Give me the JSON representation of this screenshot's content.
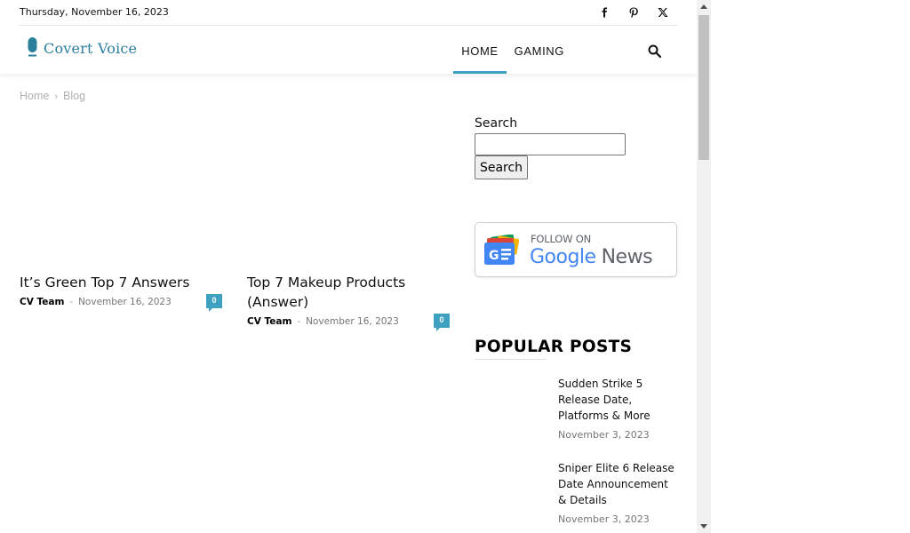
{
  "topbar": {
    "date": "Thursday, November 16, 2023",
    "social": [
      {
        "name": "facebook-icon"
      },
      {
        "name": "pinterest-icon"
      },
      {
        "name": "x-twitter-icon"
      }
    ]
  },
  "header": {
    "logo_text": "Covert Voice",
    "nav": [
      {
        "label": "HOME",
        "active": true
      },
      {
        "label": "GAMING",
        "active": false
      }
    ],
    "search_icon": "search-icon"
  },
  "breadcrumb": {
    "items": [
      "Home",
      "Blog"
    ],
    "separator": "›"
  },
  "posts": [
    {
      "title": "It’s Green Top 7 Answers",
      "author": "CV Team",
      "dash": "-",
      "date": "November 16, 2023",
      "comments": "0"
    },
    {
      "title": "Top 7 Makeup Products (Answer)",
      "author": "CV Team",
      "dash": "-",
      "date": "November 16, 2023",
      "comments": "0"
    }
  ],
  "sidebar": {
    "search_label": "Search",
    "search_value": "",
    "search_button": "Search",
    "google_news": {
      "follow": "FOLLOW ON",
      "google": "Google",
      "news": "News"
    },
    "popular_title": "POPULAR POSTS",
    "popular": [
      {
        "title": "Sudden Strike 5 Release Date, Platforms & More",
        "date": "November 3, 2023"
      },
      {
        "title": "Sniper Elite 6 Release Date Announcement & Details",
        "date": "November 3, 2023"
      }
    ]
  },
  "colors": {
    "accent": "#3ea1c0",
    "logo": "#2a7f9b"
  }
}
